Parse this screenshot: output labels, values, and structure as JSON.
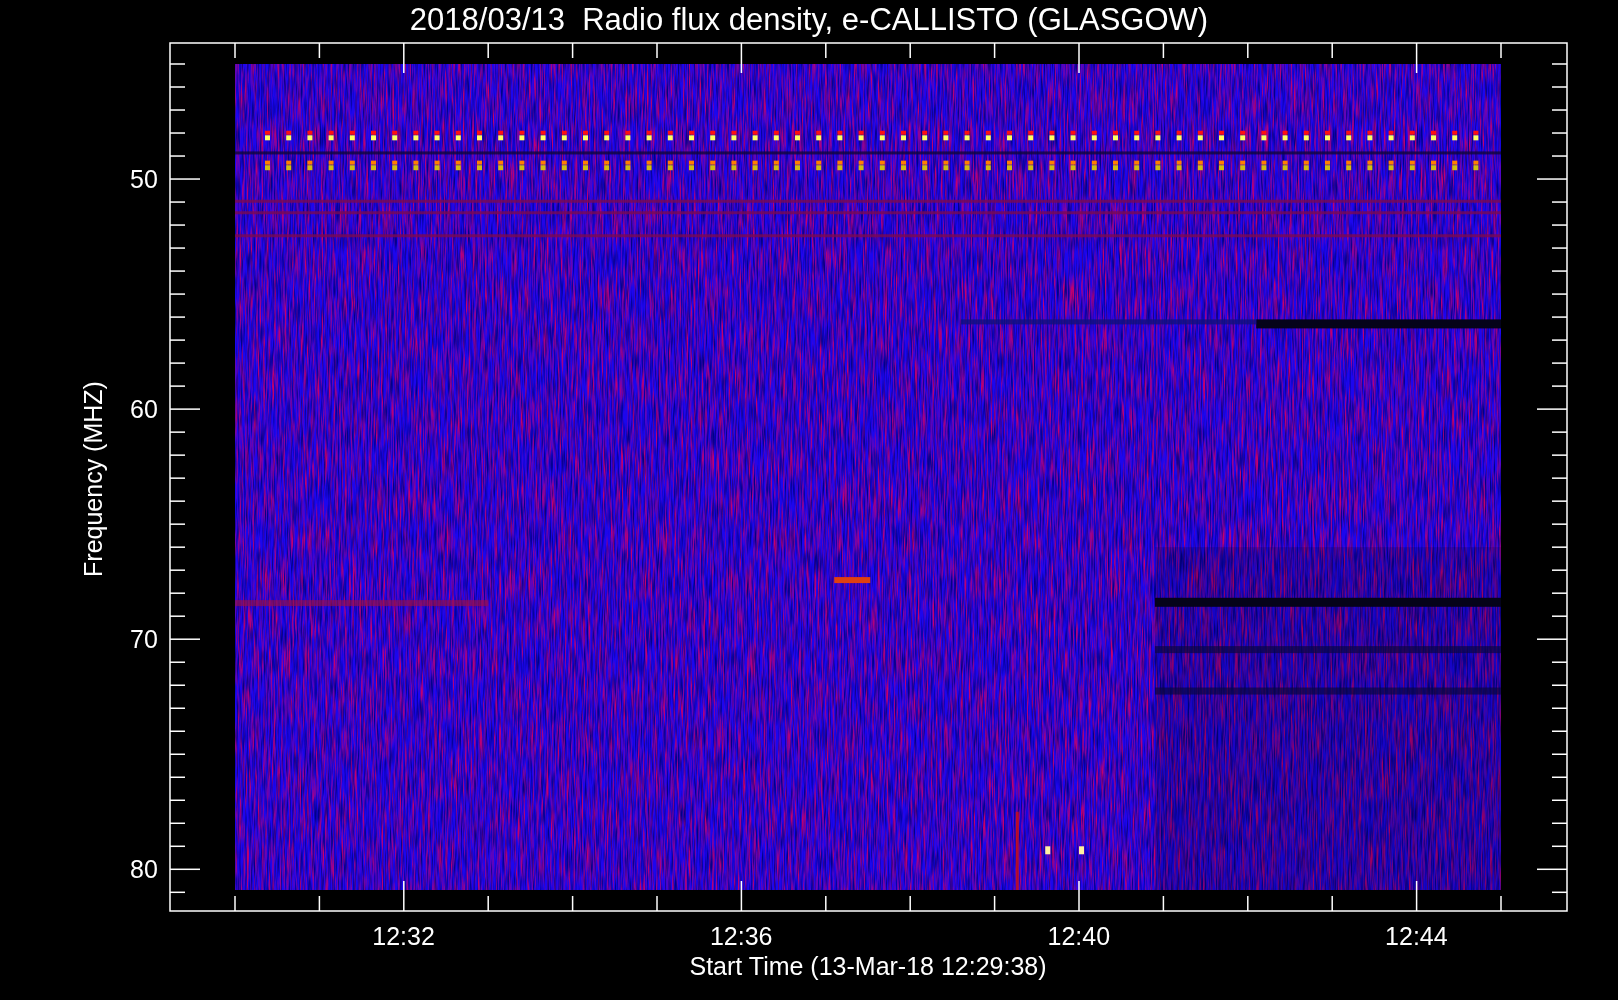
{
  "title": "2018/03/13  Radio flux density, e-CALLISTO (GLASGOW)",
  "plot": {
    "ylabel": "Frequency (MHZ)",
    "yticks": [
      "50",
      "60",
      "70",
      "80"
    ],
    "xticks": [
      "12:32",
      "12:36",
      "12:40",
      "12:44"
    ],
    "xlabel": "Start Time (13-Mar-18 12:29:38)"
  }
}
